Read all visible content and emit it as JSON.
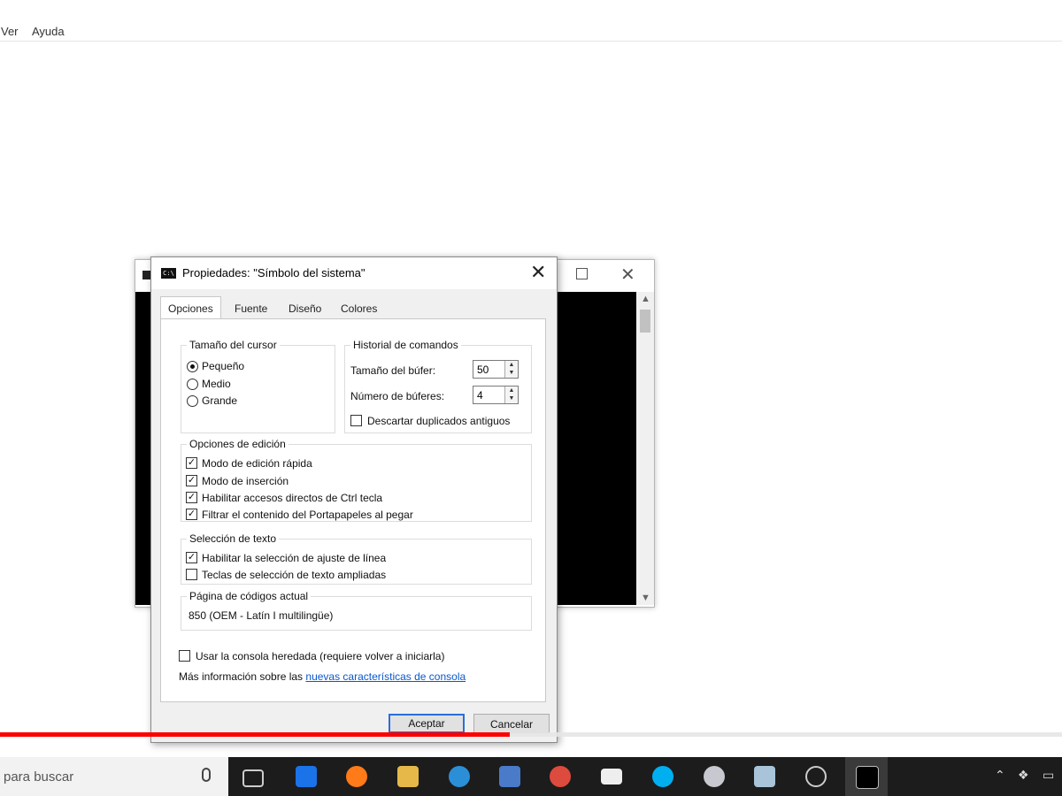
{
  "bg_menu": {
    "ver": "Ver",
    "ayuda": "Ayuda"
  },
  "dialog": {
    "title": "Propiedades: \"Símbolo del sistema\"",
    "close_glyph": "✕",
    "icon_text": "C:\\",
    "tabs": [
      "Opciones",
      "Fuente",
      "Diseño",
      "Colores"
    ],
    "cursor": {
      "legend": "Tamaño del cursor",
      "options": [
        "Pequeño",
        "Medio",
        "Grande"
      ],
      "selected": "Pequeño"
    },
    "history": {
      "legend": "Historial de comandos",
      "buffer_label": "Tamaño del búfer:",
      "buffer_value": "50",
      "count_label": "Número de búferes:",
      "count_value": "4",
      "discard_label": "Descartar duplicados antiguos",
      "discard_checked": false
    },
    "edit": {
      "legend": "Opciones de edición",
      "items": [
        {
          "label": "Modo de edición rápida",
          "checked": true
        },
        {
          "label": "Modo de inserción",
          "checked": true
        },
        {
          "label": "Habilitar accesos directos de Ctrl tecla",
          "checked": true
        },
        {
          "label": "Filtrar el contenido del Portapapeles al pegar",
          "checked": true
        }
      ]
    },
    "selection": {
      "legend": "Selección de texto",
      "items": [
        {
          "label": "Habilitar la selección de ajuste de línea",
          "checked": true
        },
        {
          "label": "Teclas de selección de texto ampliadas",
          "checked": false
        }
      ]
    },
    "codepage": {
      "legend": "Página de códigos actual",
      "value": "850   (OEM - Latín I multilingüe)"
    },
    "legacy_label": "Usar la consola heredada (requiere volver a iniciarla)",
    "legacy_checked": false,
    "more_info_prefix": "Más información sobre las",
    "more_info_link": "nuevas características de consola",
    "ok_label": "Aceptar",
    "cancel_label": "Cancelar"
  },
  "taskbar": {
    "search_placeholder": "para buscar",
    "icons": [
      "task-view-icon",
      "edge-icon",
      "firefox-icon",
      "file-explorer-icon",
      "network-icon",
      "remote-icon",
      "chrome-icon",
      "mail-icon",
      "skype-icon",
      "vpn-icon",
      "notes-icon",
      "obs-icon",
      "cmd-icon"
    ]
  },
  "video_progress": 0.48,
  "colors": {
    "progress": "#ff0000",
    "link": "#0a58ca",
    "default_button": "#2a6ed8"
  }
}
